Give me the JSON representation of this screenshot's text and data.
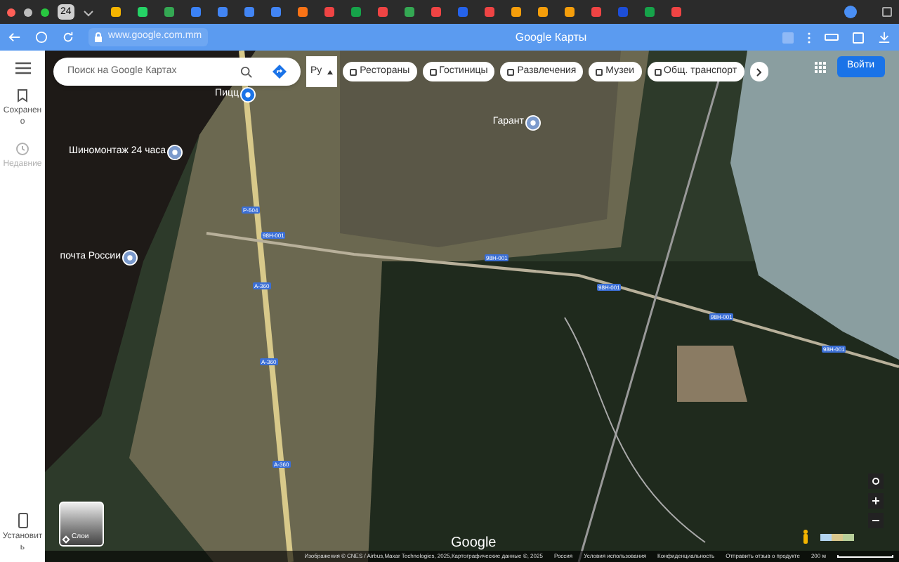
{
  "browser": {
    "tab_count": "24",
    "tab_icons": [
      {
        "color": "#f4b400"
      },
      {
        "color": "#25d366"
      },
      {
        "color": "#34a853"
      },
      {
        "color": "#3b82f6"
      },
      {
        "color": "#4285f4"
      },
      {
        "color": "#4285f4"
      },
      {
        "color": "#4285f4"
      },
      {
        "color": "#f97316"
      },
      {
        "color": "#ef4444"
      },
      {
        "color": "#16a34a"
      },
      {
        "color": "#ef4444"
      },
      {
        "color": "#34a853"
      },
      {
        "color": "#ef4444"
      },
      {
        "color": "#2563eb"
      },
      {
        "color": "#ef4444"
      },
      {
        "color": "#f59e0b"
      },
      {
        "color": "#f59e0b"
      },
      {
        "color": "#f59e0b"
      },
      {
        "color": "#ef4444"
      },
      {
        "color": "#1d4ed8"
      },
      {
        "color": "#16a34a"
      },
      {
        "color": "#ef4444"
      }
    ],
    "address": "www.google.com.mm",
    "title": "Google Карты"
  },
  "sidebar": {
    "items": [
      {
        "label": "Сохранено",
        "disabled": false
      },
      {
        "label": "Недавние",
        "disabled": true
      }
    ],
    "install": "Установить"
  },
  "search": {
    "placeholder": "Поиск на Google Картах"
  },
  "language": "Ру",
  "chips": [
    "Рестораны",
    "Гостиницы",
    "Развлечения",
    "Музеи",
    "Общ. транспорт"
  ],
  "sign_in": "Войти",
  "places": [
    {
      "name": "Шиномонтаж 24 часа",
      "kind": "service"
    },
    {
      "name": "Гарант",
      "kind": "shop"
    },
    {
      "name": "почта России",
      "kind": "post"
    },
    {
      "name": "Пицц",
      "kind": "food"
    }
  ],
  "roads": [
    "Р-504",
    "98Н-001",
    "А-360",
    "А-360",
    "А-360",
    "98Н-001",
    "98Н-001",
    "98Н-001",
    "98Н-001"
  ],
  "layers": "Слои",
  "logo": "Google",
  "footer": {
    "attribution": "Изображения © CNES / Airbus,Maxar Technologies, 2025,Картографические данные ©, 2025",
    "links": [
      "Россия",
      "Условия использования",
      "Конфиденциальность",
      "Отправить отзыв о продукте"
    ],
    "scale": "200 м"
  }
}
